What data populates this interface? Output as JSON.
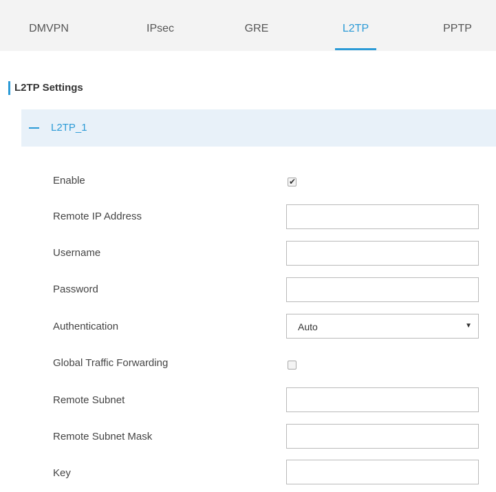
{
  "tabs": [
    {
      "label": "DMVPN",
      "active": false
    },
    {
      "label": "IPsec",
      "active": false
    },
    {
      "label": "GRE",
      "active": false
    },
    {
      "label": "L2TP",
      "active": true
    },
    {
      "label": "PPTP",
      "active": false
    }
  ],
  "colors": {
    "accent": "#2b9ad6",
    "tabbar_bg": "#f3f3f3",
    "panel_header_bg": "#e8f1f9"
  },
  "section": {
    "title": "L2TP Settings"
  },
  "panel": {
    "title": "L2TP_1",
    "toggle_icon": "minus-icon"
  },
  "form": {
    "enable": {
      "label": "Enable",
      "checked": true
    },
    "remote_ip": {
      "label": "Remote IP Address",
      "value": ""
    },
    "username": {
      "label": "Username",
      "value": ""
    },
    "password": {
      "label": "Password",
      "value": ""
    },
    "authentication": {
      "label": "Authentication",
      "value": "Auto"
    },
    "global_traffic": {
      "label": "Global Traffic Forwarding",
      "checked": false
    },
    "remote_subnet": {
      "label": "Remote Subnet",
      "value": ""
    },
    "remote_subnet_mask": {
      "label": "Remote Subnet Mask",
      "value": ""
    },
    "key": {
      "label": "Key",
      "value": ""
    }
  }
}
